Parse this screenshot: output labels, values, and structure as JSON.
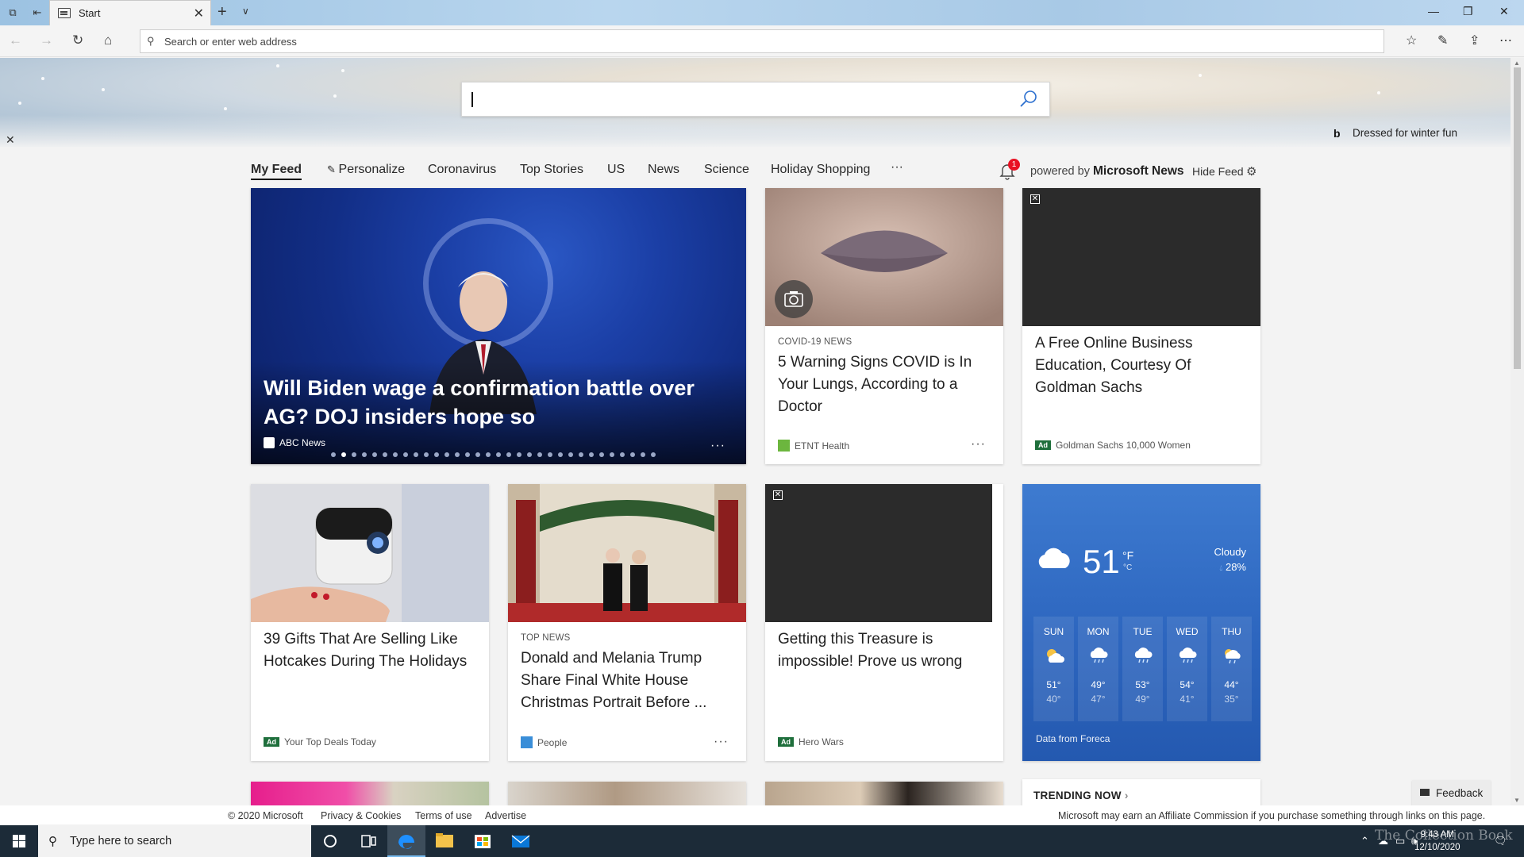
{
  "browser": {
    "tab_title": "Start",
    "address_placeholder": "Search or enter web address"
  },
  "hero": {
    "attribution": "Dressed for winter fun"
  },
  "feed_nav": {
    "items": [
      "My Feed",
      "Personalize",
      "Coronavirus",
      "Top Stories",
      "US",
      "News",
      "Science",
      "Holiday Shopping"
    ],
    "more": "···",
    "notification_count": "1",
    "powered_prefix": "powered by",
    "powered_brand": "Microsoft News",
    "hide_feed": "Hide Feed"
  },
  "cards": {
    "main": {
      "headline": "Will Biden wage a confirmation battle over AG? DOJ insiders hope so",
      "source": "ABC News",
      "slide_count": 32,
      "active_slide": 2
    },
    "covid": {
      "kicker": "COVID-19 NEWS",
      "headline": "5 Warning Signs COVID is In Your Lungs, According to a Doctor",
      "source": "ETNT Health"
    },
    "goldman": {
      "headline": "A Free Online Business Education, Courtesy Of Goldman Sachs",
      "ad_label": "Ad",
      "source": "Goldman Sachs 10,000 Women"
    },
    "gifts": {
      "headline": "39 Gifts That Are Selling Like Hotcakes During The Holidays",
      "ad_label": "Ad",
      "source": "Your Top Deals Today"
    },
    "trump": {
      "kicker": "TOP NEWS",
      "headline": "Donald and Melania Trump Share Final White House Christmas Portrait Before ...",
      "source": "People"
    },
    "herowars": {
      "headline": "Getting this Treasure is impossible! Prove us wrong",
      "ad_label": "Ad",
      "source": "Hero Wars"
    }
  },
  "weather": {
    "temp": "51",
    "unit_f": "°F",
    "unit_c": "°C",
    "condition": "Cloudy",
    "precip": "28%",
    "days": [
      {
        "name": "SUN",
        "hi": "51°",
        "lo": "40°",
        "icon": "partly-sunny-icon"
      },
      {
        "name": "MON",
        "hi": "49°",
        "lo": "47°",
        "icon": "rain-icon"
      },
      {
        "name": "TUE",
        "hi": "53°",
        "lo": "49°",
        "icon": "rain-icon"
      },
      {
        "name": "WED",
        "hi": "54°",
        "lo": "41°",
        "icon": "rain-icon"
      },
      {
        "name": "THU",
        "hi": "44°",
        "lo": "35°",
        "icon": "sun-rain-icon"
      }
    ],
    "source": "Data from Foreca"
  },
  "trending": {
    "label": "TRENDING NOW",
    "chevron": "›"
  },
  "feedback": "Feedback",
  "footer": {
    "copyright": "© 2020 Microsoft",
    "privacy": "Privacy & Cookies",
    "terms": "Terms of use",
    "advertise": "Advertise",
    "affiliate": "Microsoft may earn an Affiliate Commission if you purchase something through links on this page."
  },
  "taskbar": {
    "search_placeholder": "Type here to search",
    "time": "9:43 AM",
    "date": "12/10/2020",
    "watermark": "The Collection Book"
  },
  "colors": {
    "accent": "#2d66bf",
    "ad_tag": "#1f6f3c",
    "badge": "#e81123"
  }
}
